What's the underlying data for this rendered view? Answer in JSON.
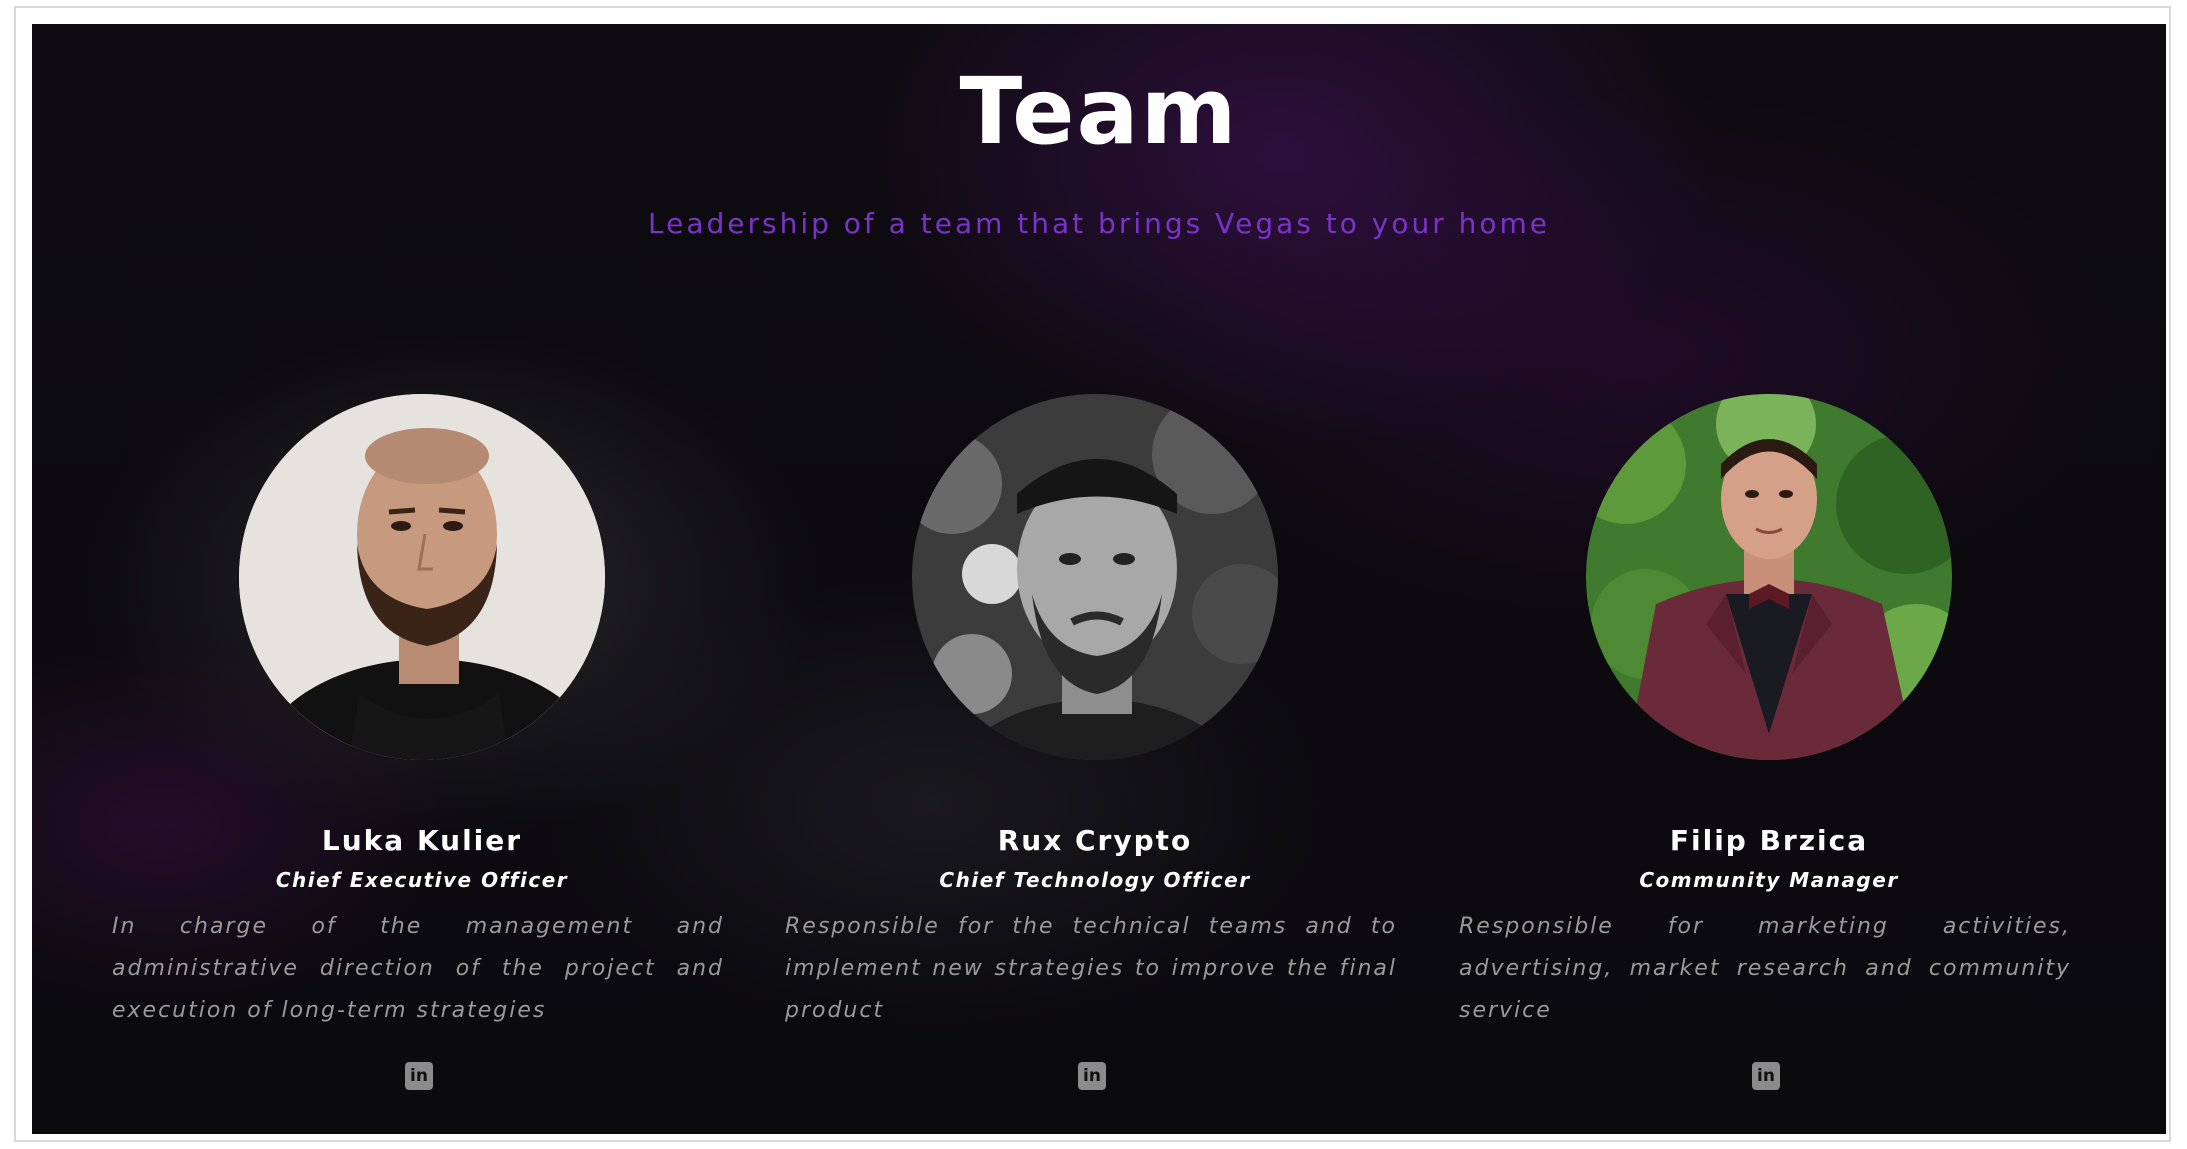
{
  "section": {
    "title": "Team",
    "subtitle": "Leadership of a team that brings Vegas to your home"
  },
  "members": [
    {
      "name": "Luka Kulier",
      "role": "Chief Executive Officer",
      "bio": "In charge of the management and administrative direction of the project and execution of long-term strategies",
      "social_icon": "linkedin-icon",
      "social_label": "in"
    },
    {
      "name": "Rux Crypto",
      "role": "Chief Technology Officer",
      "bio": "Responsible for the technical teams and to implement new strategies to improve the final product",
      "social_icon": "linkedin-icon",
      "social_label": "in"
    },
    {
      "name": "Filip Brzica",
      "role": "Community Manager",
      "bio": "Responsible for marketing activities, advertising, market research and community service",
      "social_icon": "linkedin-icon",
      "social_label": "in"
    }
  ],
  "colors": {
    "background": "#0b0a0d",
    "accent": "#7a33c9",
    "text": "#ffffff",
    "muted_text": "#9a9a9a"
  }
}
